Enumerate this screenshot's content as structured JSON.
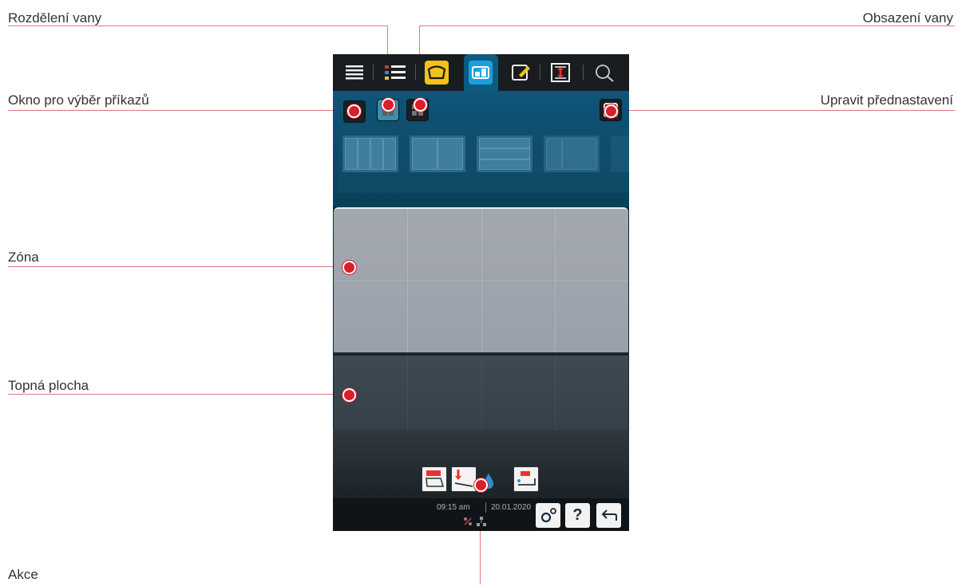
{
  "callouts": {
    "rozdeleni_vany": "Rozdělení vany",
    "obsazeni_vany": "Obsazení vany",
    "okno_prikazu": "Okno pro výběr příkazů",
    "upravit_prednastaveni": "Upravit přednastavení",
    "zona": "Zóna",
    "topna_plocha": "Topná plocha",
    "akce": "Akce"
  },
  "nav": {
    "icons": [
      "menu-icon",
      "list-filter-icon",
      "pan-icon",
      "split-view-icon",
      "edit-note-icon",
      "height-adjust-icon",
      "search-icon"
    ],
    "active_tab": "split-view-icon"
  },
  "mode_buttons": [
    "single-zone-icon",
    "split-zone-icon",
    "quarter-zone-icon"
  ],
  "presets": [
    "four-column-preset",
    "two-column-preset",
    "three-row-preset",
    "two-column-preset-alt"
  ],
  "action_buttons": [
    "auto-pan-icon",
    "tilt-pan-icon",
    "water-drop-icon",
    "fill-pan-icon"
  ],
  "status": {
    "time": "09:15 am",
    "date": "20.01.2020"
  },
  "colors": {
    "accent_red": "#d81f2a",
    "active_tab": "#0d5b80",
    "yellow_tab": "#f2c21b"
  }
}
